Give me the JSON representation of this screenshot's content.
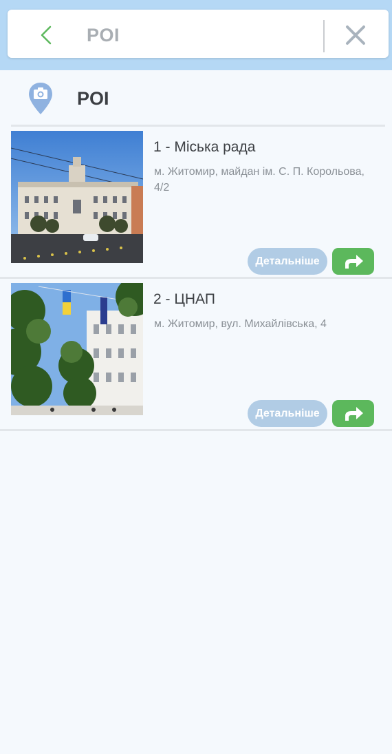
{
  "search": {
    "title": "POI"
  },
  "section": {
    "title": "POI"
  },
  "items": [
    {
      "name": "1 - Міська рада",
      "address": "м. Житомир, майдан ім. С. П. Корольова, 4/2",
      "details_label": "Детальніше"
    },
    {
      "name": "2 - ЦНАП",
      "address": "м. Житомир, вул. Михайлівська, 4",
      "details_label": "Детальніше"
    }
  ],
  "colors": {
    "header_bg": "#b5d8f5",
    "accent_green": "#5cb85c",
    "details_button": "#b1cce5",
    "pin_blue": "#8fb2e0"
  },
  "icons": [
    "back-arrow-icon",
    "close-icon",
    "map-pin-camera-icon",
    "route-arrow-icon"
  ]
}
